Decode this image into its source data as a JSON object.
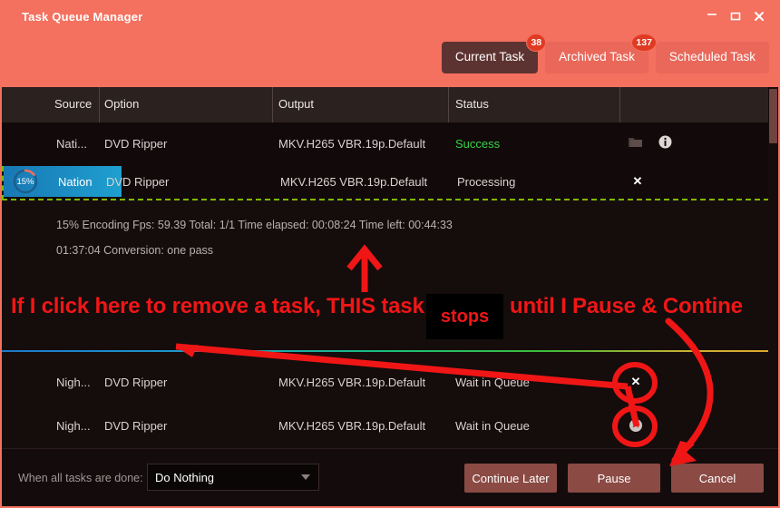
{
  "window": {
    "title": "Task Queue Manager",
    "controls": [
      {
        "name": "minimize",
        "glyph": "–"
      },
      {
        "name": "maximize",
        "glyph": "□"
      },
      {
        "name": "close",
        "glyph": "✕"
      }
    ]
  },
  "tabs": [
    {
      "label": "Current Task",
      "badge": "38",
      "active": true
    },
    {
      "label": "Archived Task",
      "badge": "137",
      "active": false
    },
    {
      "label": "Scheduled Task",
      "badge": "",
      "active": false
    }
  ],
  "table": {
    "headers": [
      "Source",
      "Option",
      "Output",
      "Status"
    ],
    "rows": [
      {
        "source": "Nati...",
        "option": "DVD Ripper",
        "output": "MKV.H265 VBR.19p.Default",
        "status": "Success",
        "status_color": "#36d148",
        "actions": [
          "folder-icon",
          "info-icon"
        ]
      },
      {
        "source": "Nation",
        "option": "DVD Ripper",
        "output": "MKV.H265 VBR.19p.Default",
        "status": "Processing",
        "progress_pct": "15%",
        "progress_value": 15,
        "actions": [
          "close-icon"
        ]
      },
      {
        "source": "Nigh...",
        "option": "DVD Ripper",
        "output": "MKV.H265 VBR.19p.Default",
        "status": "Wait in Queue",
        "actions": [
          "close-icon"
        ]
      },
      {
        "source": "Nigh...",
        "option": "DVD Ripper",
        "output": "MKV.H265 VBR.19p.Default",
        "status": "Wait in Queue",
        "actions": [
          "close-icon"
        ]
      }
    ]
  },
  "progress_detail": {
    "line1": "15%  Encoding Fps: 59.39  Total: 1/1  Time elapsed: 00:08:24  Time left: 00:44:33",
    "line2": "01:37:04    Conversion: one pass"
  },
  "footer": {
    "when_done_label": "When all tasks are done:",
    "when_done_value": "Do Nothing",
    "buttons": [
      {
        "label": "Continue Later"
      },
      {
        "label": "Pause"
      },
      {
        "label": "Cancel"
      }
    ]
  },
  "annotations": {
    "text_before": "If I click here to remove a task, THIS task",
    "text_highlight": "stops",
    "text_after": "until I Pause & Contine",
    "color": "#f01616"
  },
  "colors": {
    "title_bar": "#f4705f",
    "tab_active": "#5d3331",
    "badge": "#e03a23",
    "progress_blue": "#1f9fd0",
    "success_green": "#36d148",
    "button": "#8b4a44"
  }
}
